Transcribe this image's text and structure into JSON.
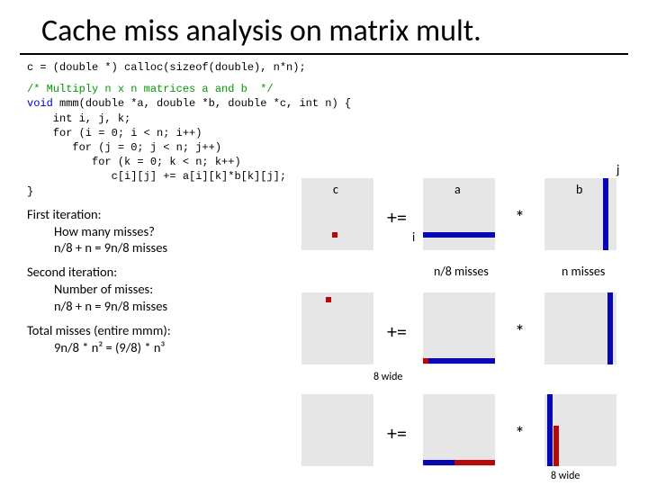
{
  "title": "Cache miss analysis on matrix mult.",
  "code_alloc": "c = (double *) calloc(sizeof(double), n*n);",
  "code_comment": "/* Multiply n x n matrices a and b  */",
  "code_sig1": "void",
  "code_sig2": " mmm(double *a, double *b, double *c, int n) {",
  "code_body": "    int i, j, k;\n    for (i = 0; i < n; i++)\n       for (j = 0; j < n; j++)\n          for (k = 0; k < n; k++)\n             c[i][j] += a[i][k]*b[k][j];\n}",
  "notes": {
    "q1a": "First iteration:",
    "q1b": "How many misses?",
    "q1c": "n/8 + n = 9n/8 misses",
    "q2a": "Second iteration:",
    "q2b": "Number of misses:",
    "q2c": "n/8 + n = 9n/8 misses",
    "q3a": "Total misses (entire mmm):",
    "q3b": "9n/8 * n² = (9/8) * n³"
  },
  "labels": {
    "c": "c",
    "a": "a",
    "b": "b",
    "j": "j",
    "i": "i",
    "plus_eq": "+=",
    "star": "*",
    "n8": "n/8 misses",
    "nm": "n misses",
    "eight": "8 wide"
  }
}
